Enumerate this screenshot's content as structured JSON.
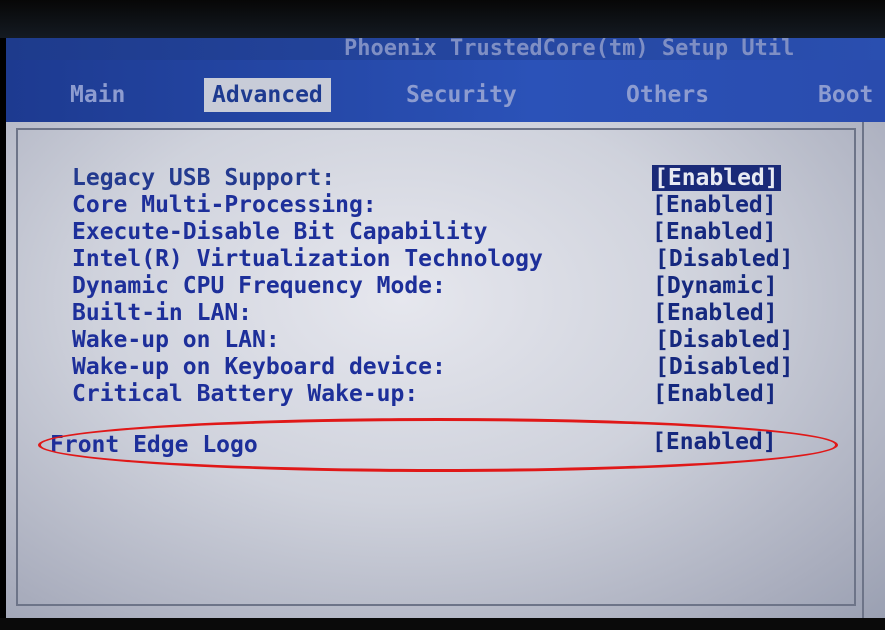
{
  "title": "Phoenix TrustedCore(tm) Setup Util",
  "menu": [
    "Main",
    "Advanced",
    "Security",
    "Others",
    "Boot"
  ],
  "settings": [
    {
      "label": "Legacy USB Support:",
      "value": "[Enabled]"
    },
    {
      "label": "Core Multi-Processing:",
      "value": "[Enabled]"
    },
    {
      "label": "Execute-Disable Bit Capability",
      "value": "[Enabled]"
    },
    {
      "label": "Intel(R) Virtualization Technology",
      "value": "[Disabled]"
    },
    {
      "label": "Dynamic CPU Frequency Mode:",
      "value": "[Dynamic]"
    },
    {
      "label": "Built-in LAN:",
      "value": "[Enabled]"
    },
    {
      "label": "Wake-up on LAN:",
      "value": "[Disabled]"
    },
    {
      "label": "Wake-up on Keyboard device:",
      "value": "[Disabled]"
    },
    {
      "label": "Critical Battery Wake-up:",
      "value": "[Enabled]"
    },
    {
      "label": "Front Edge Logo",
      "value": "[Enabled]"
    }
  ],
  "colors": {
    "menu_bar": "#2b52b8",
    "label_text": "#1d2f9a",
    "selected_value_bg": "#1a2a78",
    "annotation_circle": "#e01818"
  }
}
